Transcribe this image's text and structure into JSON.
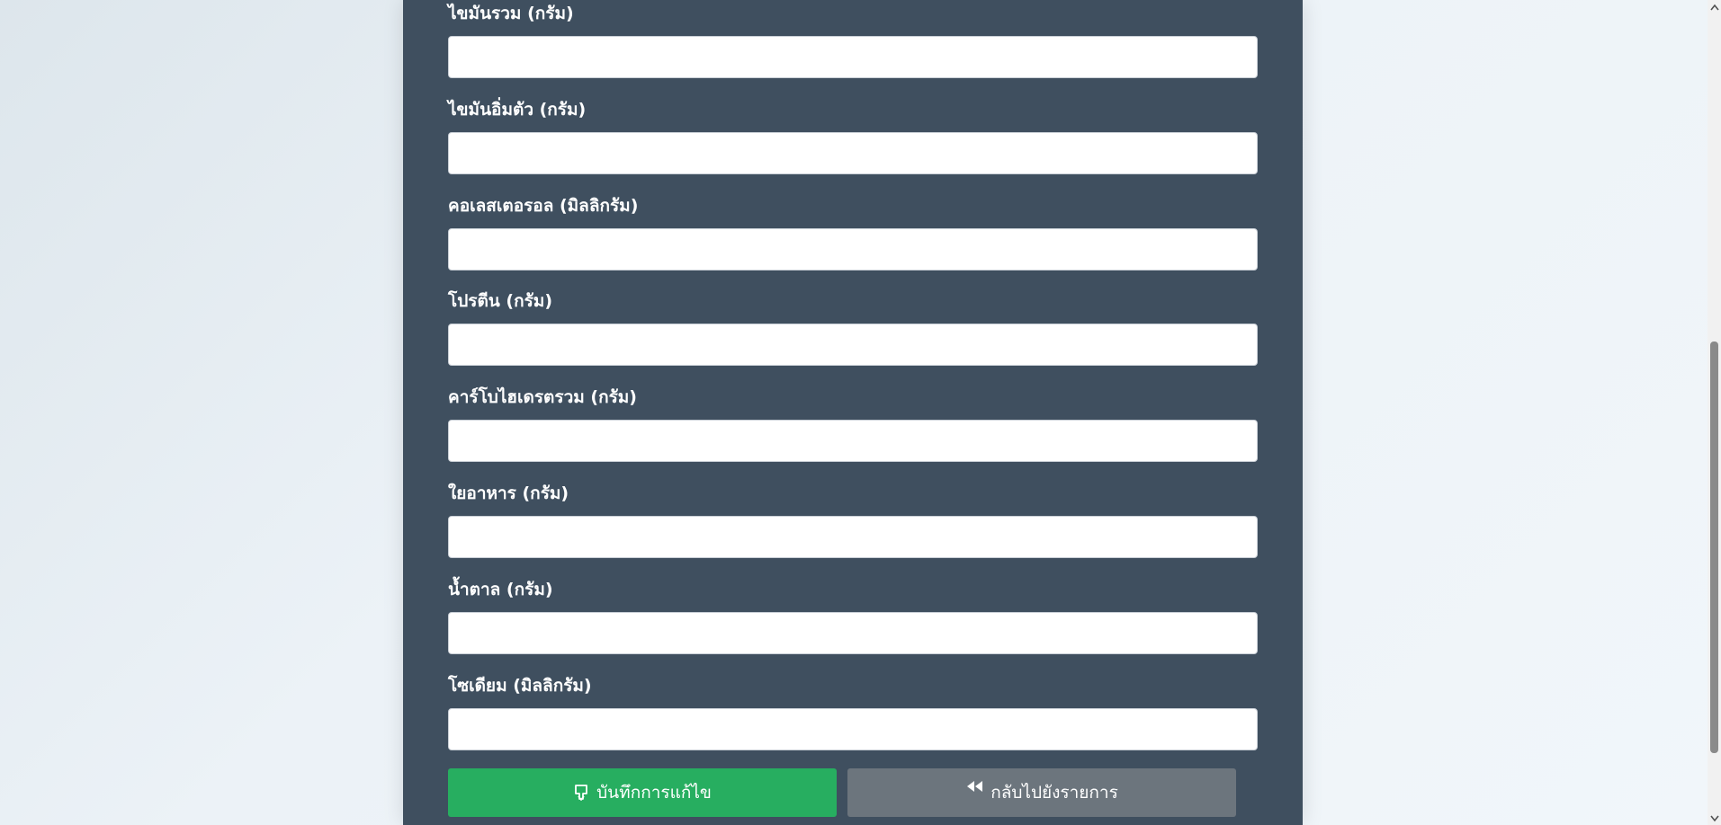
{
  "form": {
    "fields": [
      {
        "label": "ไขมันรวม (กรัม)",
        "value": ""
      },
      {
        "label": "ไขมันอิ่มตัว (กรัม)",
        "value": ""
      },
      {
        "label": "คอเลสเตอรอล (มิลลิกรัม)",
        "value": ""
      },
      {
        "label": "โปรตีน (กรัม)",
        "value": ""
      },
      {
        "label": "คาร์โบไฮเดรตรวม (กรัม)",
        "value": ""
      },
      {
        "label": "ใยอาหาร (กรัม)",
        "value": ""
      },
      {
        "label": "น้ำตาล (กรัม)",
        "value": ""
      },
      {
        "label": "โซเดียม (มิลลิกรัม)",
        "value": ""
      }
    ]
  },
  "actions": {
    "save_label": "บันทึกการแก้ไข",
    "save_icon": "save-icon",
    "back_label": "กลับไปยังรายการ",
    "back_icon": "rewind-icon"
  },
  "colors": {
    "panel": "#3f4f5f",
    "save_button": "#27ae60",
    "back_button": "#6c757d"
  }
}
